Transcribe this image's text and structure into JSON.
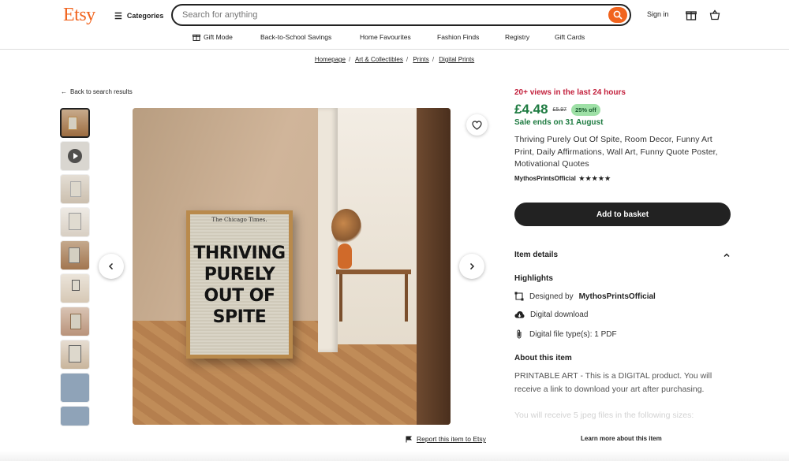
{
  "header": {
    "logo": "Etsy",
    "categories_label": "Categories",
    "search_placeholder": "Search for anything",
    "signin_label": "Sign in"
  },
  "nav": {
    "items": [
      "Gift Mode",
      "Back-to-School Savings",
      "Home Favourites",
      "Fashion Finds",
      "Registry",
      "Gift Cards"
    ]
  },
  "breadcrumb": [
    "Homepage",
    "Art & Collectibles",
    "Prints",
    "Digital Prints"
  ],
  "back_label": "Back to search results",
  "poster": {
    "masthead": "The Chicago Times.",
    "lines": [
      "THRIVING",
      "PURELY",
      "OUT OF",
      "SPITE"
    ]
  },
  "product": {
    "views": "20+ views in the last 24 hours",
    "price": "£4.48",
    "old_price": "£5.97",
    "discount": "25% off",
    "sale": "Sale ends on 31 August",
    "title": "Thriving Purely Out Of Spite, Room Decor, Funny Art Print, Daily Affirmations, Wall Art, Funny Quote Poster, Motivational Quotes",
    "shop": "MythosPrintsOfficial",
    "stars": "★★★★★",
    "basket_label": "Add to basket",
    "item_details": "Item details",
    "highlights": "Highlights",
    "designed_prefix": "Designed by",
    "designed_by": "MythosPrintsOfficial",
    "digital_download": "Digital download",
    "file_types": "Digital file type(s): 1 PDF",
    "about_heading": "About this item",
    "about_text": "PRINTABLE ART - This is a DIGITAL product. You will receive a link to download your art after purchasing.",
    "about_fade": "You will receive 5 jpeg files in the following sizes:"
  },
  "report_label": "Report this item to Etsy",
  "learn_more": "Learn more about this item",
  "colors": {
    "brand": "#f1641e",
    "price": "#1e7b41",
    "views": "#c3213d"
  }
}
